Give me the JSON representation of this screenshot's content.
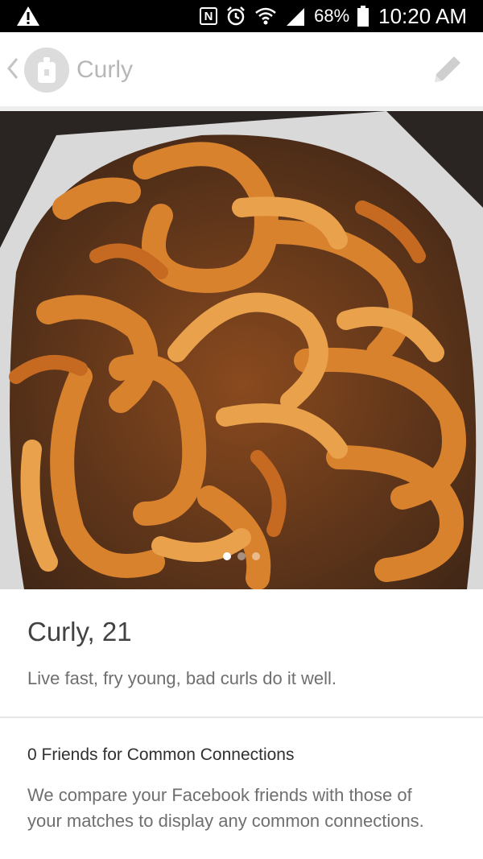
{
  "status_bar": {
    "battery": "68%",
    "time": "10:20 AM",
    "nfc_label": "N",
    "icons": [
      "warning-icon",
      "nfc-icon",
      "alarm-icon",
      "wifi-icon",
      "signal-icon",
      "battery-icon"
    ]
  },
  "header": {
    "name": "Curly",
    "icons": [
      "back-icon",
      "avatar-icon",
      "edit-pencil-icon"
    ]
  },
  "photo": {
    "subject": "curly fries",
    "pages": 3,
    "active_page": 1
  },
  "profile": {
    "title": "Curly, 21",
    "bio": "Live fast, fry young, bad curls do it well."
  },
  "connections": {
    "title": "0 Friends for Common Connections",
    "description": "We compare your Facebook friends with those of your matches to display any common connections."
  },
  "colors": {
    "status_bar_bg": "#000000",
    "header_name": "#b7b7b7",
    "text_primary": "#424242",
    "text_secondary": "#6f6f6f",
    "fry": "#e08b3a"
  }
}
